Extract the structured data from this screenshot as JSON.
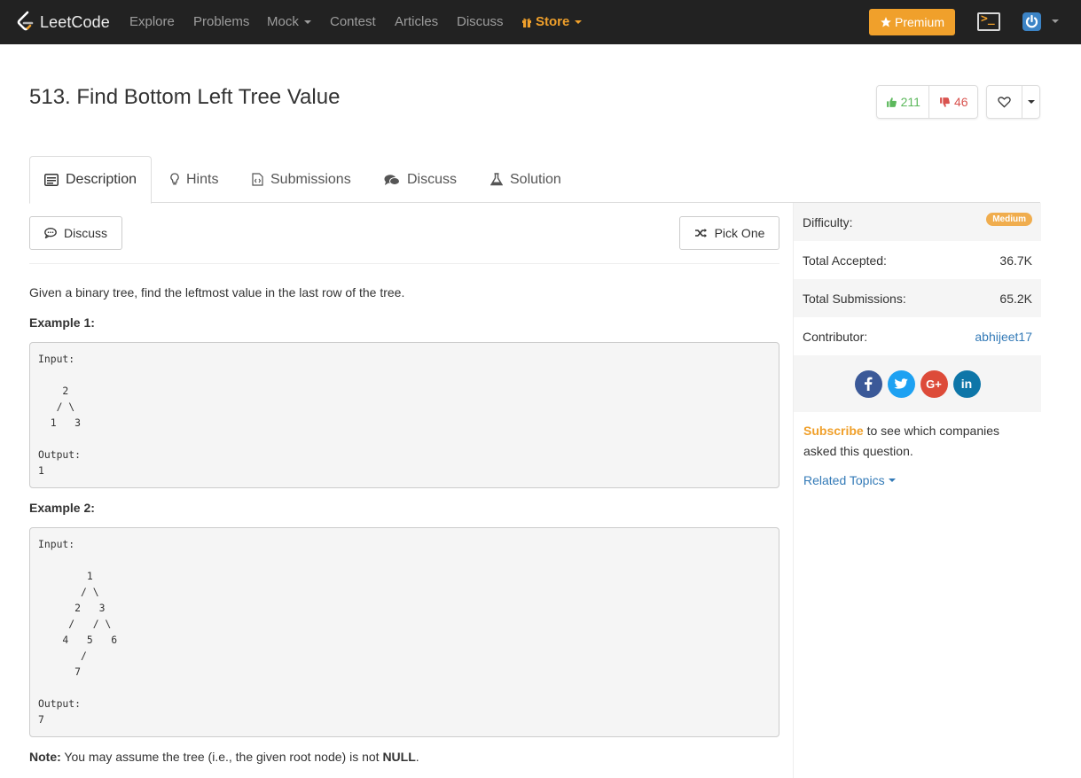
{
  "nav": {
    "brand": "LeetCode",
    "links": [
      "Explore",
      "Problems",
      "Mock",
      "Contest",
      "Articles",
      "Discuss"
    ],
    "store": "Store",
    "premium": "Premium"
  },
  "problem": {
    "title": "513. Find Bottom Left Tree Value",
    "likes": "211",
    "dislikes": "46"
  },
  "tabs": [
    "Description",
    "Hints",
    "Submissions",
    "Discuss",
    "Solution"
  ],
  "actions": {
    "discuss": "Discuss",
    "pick_one": "Pick One"
  },
  "description": {
    "intro": "Given a binary tree, find the leftmost value in the last row of the tree.",
    "example1_heading": "Example 1:",
    "example1_code": "Input:\n\n    2\n   / \\\n  1   3\n\nOutput:\n1",
    "example2_heading": "Example 2:",
    "example2_code": "Input:\n\n        1\n       / \\\n      2   3\n     /   / \\\n    4   5   6\n       /\n      7\n\nOutput:\n7",
    "note_label": "Note:",
    "note_text": " You may assume the tree (i.e., the given root node) is not ",
    "note_null": "NULL",
    "note_end": "."
  },
  "sidebar": {
    "difficulty_label": "Difficulty:",
    "difficulty_value": "Medium",
    "accepted_label": "Total Accepted:",
    "accepted_value": "36.7K",
    "submissions_label": "Total Submissions:",
    "submissions_value": "65.2K",
    "contributor_label": "Contributor:",
    "contributor_value": "abhijeet17",
    "subscribe_link": "Subscribe",
    "subscribe_text": " to see which companies asked this question.",
    "related_topics": "Related Topics"
  },
  "colors": {
    "navbar": "#222222",
    "accent": "#f0a02b",
    "link": "#337ab7",
    "upvote": "#5cb85c",
    "downvote": "#d9534f",
    "facebook": "#3b5998",
    "twitter": "#1da1f2",
    "googleplus": "#dd4b39",
    "linkedin": "#0e76a8"
  },
  "icons": [
    "leetcode-logo-icon",
    "star-icon",
    "gift-icon",
    "terminal-icon",
    "user-power-icon",
    "thumbs-up-icon",
    "thumbs-down-icon",
    "heart-icon",
    "list-icon",
    "lightbulb-icon",
    "file-code-icon",
    "comments-icon",
    "flask-icon",
    "comment-icon",
    "shuffle-icon",
    "facebook-icon",
    "twitter-icon",
    "google-plus-icon",
    "linkedin-icon"
  ]
}
